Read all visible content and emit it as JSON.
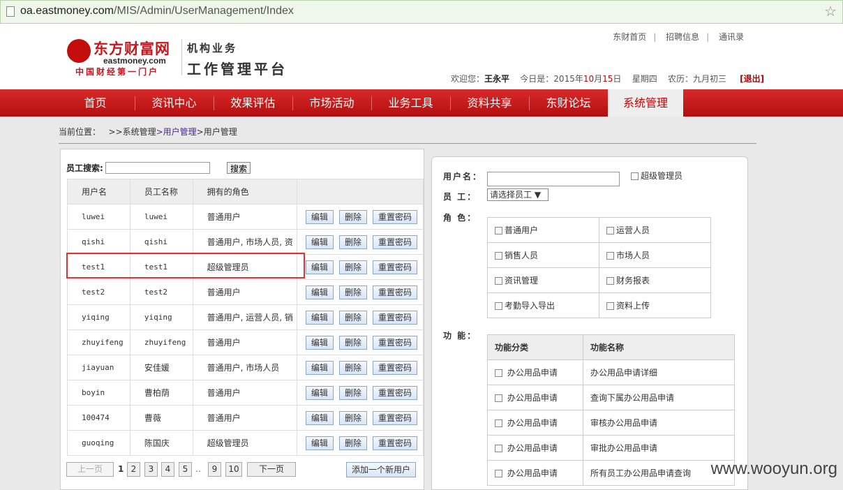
{
  "browser": {
    "url_host": "oa.eastmoney.com",
    "url_path": "/MIS/Admin/UserManagement/Index"
  },
  "logo": {
    "brand": "东方财富网",
    "domain": "eastmoney.com",
    "slogan": "中国财经第一门户"
  },
  "platform": {
    "line1": "机构业务",
    "line2": "工作管理平台"
  },
  "toplinks": [
    "东财首页",
    "招聘信息",
    "通讯录"
  ],
  "userinfo": {
    "welcome": "欢迎您：",
    "name": "王永平",
    "today_label": "今日是：2015年",
    "month": "10",
    "month_unit": "月",
    "day": "15",
    "day_unit": "日",
    "weekday": "星期四",
    "lunar": "农历：九月初三",
    "logout": "[退出]"
  },
  "nav": [
    "首页",
    "资讯中心",
    "效果评估",
    "市场活动",
    "业务工具",
    "资料共享",
    "东财论坛",
    "系统管理"
  ],
  "crumb": {
    "prefix": "当前位置：",
    "l1": ">>系统管理",
    "l2": ">用户管理",
    "l3": ">用户管理"
  },
  "search": {
    "label": "员工搜索:",
    "button": "搜索"
  },
  "table": {
    "headers": [
      "用户名",
      "员工名称",
      "拥有的角色",
      ""
    ],
    "actions": {
      "edit": "编辑",
      "delete": "删除",
      "reset": "重置密码"
    },
    "rows": [
      {
        "user": "luwei",
        "name": "luwei",
        "roles": "普通用户"
      },
      {
        "user": "qishi",
        "name": "qishi",
        "roles": "普通用户, 市场人员, 资"
      },
      {
        "user": "test1",
        "name": "test1",
        "roles": "超级管理员"
      },
      {
        "user": "test2",
        "name": "test2",
        "roles": "普通用户"
      },
      {
        "user": "yiqing",
        "name": "yiqing",
        "roles": "普通用户, 运营人员, 销"
      },
      {
        "user": "zhuyifeng",
        "name": "zhuyifeng",
        "roles": "普通用户"
      },
      {
        "user": "jiayuan",
        "name": "安佳媛",
        "roles": "普通用户, 市场人员"
      },
      {
        "user": "boyin",
        "name": "曹柏荫",
        "roles": "普通用户"
      },
      {
        "user": "100474",
        "name": "曹薇",
        "roles": "普通用户"
      },
      {
        "user": "guoqing",
        "name": "陈国庆",
        "roles": "超级管理员"
      }
    ]
  },
  "pager": {
    "prev": "上一页",
    "current": "1",
    "pages": [
      "2",
      "3",
      "4",
      "5"
    ],
    "ellipsis": "..",
    "tail": [
      "9",
      "10"
    ],
    "next": "下一页",
    "add": "添加一个新用户"
  },
  "form": {
    "username_label": "用户名：",
    "super_admin": "超级管理员",
    "employee_label": "员 工：",
    "employee_select": "请选择员工",
    "role_label": "角 色：",
    "roles": [
      [
        "普通用户",
        "运营人员"
      ],
      [
        "销售人员",
        "市场人员"
      ],
      [
        "资讯管理",
        "财务报表"
      ],
      [
        "考勤导入导出",
        "资料上传"
      ]
    ],
    "func_label": "功 能：",
    "func_headers": [
      "功能分类",
      "功能名称"
    ],
    "funcs": [
      {
        "cat": "办公用品申请",
        "name": "办公用品申请详细"
      },
      {
        "cat": "办公用品申请",
        "name": "查询下属办公用品申请"
      },
      {
        "cat": "办公用品申请",
        "name": "审核办公用品申请"
      },
      {
        "cat": "办公用品申请",
        "name": "审批办公用品申请"
      },
      {
        "cat": "办公用品申请",
        "name": "所有员工办公用品申请查询"
      }
    ]
  },
  "watermark": "www.wooyun.org"
}
